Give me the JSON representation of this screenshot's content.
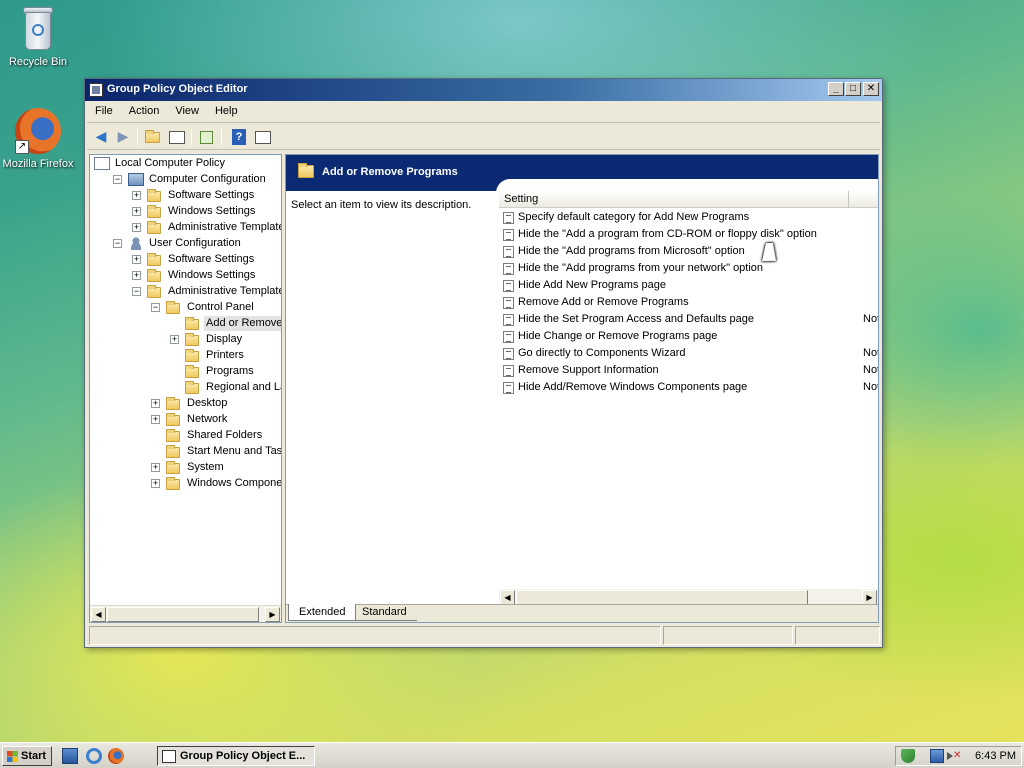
{
  "desktop": {
    "icons": [
      {
        "label": "Recycle Bin",
        "icon": "recycle-bin-icon"
      },
      {
        "label": "Mozilla Firefox",
        "icon": "firefox-icon"
      }
    ]
  },
  "window": {
    "title": "Group Policy Object Editor",
    "controls": {
      "minimize": "_",
      "maximize": "□",
      "close": "✕"
    },
    "menu": [
      "File",
      "Action",
      "View",
      "Help"
    ],
    "toolbar": [
      "back-arrow-icon",
      "forward-arrow-icon",
      "up-folder-icon",
      "show-hide-tree-icon",
      "export-list-icon",
      "help-icon",
      "properties-icon"
    ],
    "tree": [
      {
        "label": "Local Computer Policy",
        "icon": "policy-doc-icon"
      },
      {
        "label": "Computer Configuration",
        "icon": "computer-icon",
        "expander": "−"
      },
      {
        "label": "Software Settings",
        "icon": "folder-icon",
        "expander": "+"
      },
      {
        "label": "Windows Settings",
        "icon": "folder-icon",
        "expander": "+"
      },
      {
        "label": "Administrative Templates",
        "icon": "folder-icon",
        "expander": "+"
      },
      {
        "label": "User Configuration",
        "icon": "user-icon",
        "expander": "−"
      },
      {
        "label": "Software Settings",
        "icon": "folder-icon",
        "expander": "+"
      },
      {
        "label": "Windows Settings",
        "icon": "folder-icon",
        "expander": "+"
      },
      {
        "label": "Administrative Templates",
        "icon": "folder-icon",
        "expander": "−"
      },
      {
        "label": "Control Panel",
        "icon": "folder-icon",
        "expander": "−"
      },
      {
        "label": "Add or Remove Pro",
        "icon": "folder-open-icon",
        "expander": "",
        "selected": true
      },
      {
        "label": "Display",
        "icon": "folder-icon",
        "expander": "+"
      },
      {
        "label": "Printers",
        "icon": "folder-icon",
        "expander": ""
      },
      {
        "label": "Programs",
        "icon": "folder-icon",
        "expander": ""
      },
      {
        "label": "Regional and Langu",
        "icon": "folder-icon",
        "expander": ""
      },
      {
        "label": "Desktop",
        "icon": "folder-icon",
        "expander": "+"
      },
      {
        "label": "Network",
        "icon": "folder-icon",
        "expander": "+"
      },
      {
        "label": "Shared Folders",
        "icon": "folder-icon",
        "expander": ""
      },
      {
        "label": "Start Menu and Taskba",
        "icon": "folder-icon",
        "expander": ""
      },
      {
        "label": "System",
        "icon": "folder-icon",
        "expander": "+"
      },
      {
        "label": "Windows Components",
        "icon": "folder-icon",
        "expander": "+"
      }
    ],
    "details": {
      "header": "Add or Remove Programs",
      "description": "Select an item to view its description.",
      "column": "Setting",
      "settings": [
        {
          "name": "Specify default category for Add New Programs",
          "state": ""
        },
        {
          "name": "Hide the \"Add a program from CD-ROM or floppy disk\" option",
          "state": ""
        },
        {
          "name": "Hide the \"Add programs from Microsoft\" option",
          "state": ""
        },
        {
          "name": "Hide the \"Add programs from your network\" option",
          "state": ""
        },
        {
          "name": "Hide Add New Programs page",
          "state": ""
        },
        {
          "name": "Remove Add or Remove Programs",
          "state": ""
        },
        {
          "name": "Hide the Set Program Access and Defaults page",
          "state": "Not"
        },
        {
          "name": "Hide Change or Remove Programs page",
          "state": ""
        },
        {
          "name": "Go directly to Components Wizard",
          "state": "Not"
        },
        {
          "name": "Remove Support Information",
          "state": "Not"
        },
        {
          "name": "Hide Add/Remove Windows Components page",
          "state": "Not"
        }
      ],
      "tabs": [
        "Extended",
        "Standard"
      ],
      "active_tab": "Extended"
    }
  },
  "taskbar": {
    "start_label": "Start",
    "quick_launch": [
      "show-desktop-icon",
      "internet-explorer-icon",
      "firefox-icon"
    ],
    "task_button": "Group Policy Object E...",
    "tray_icons": [
      "security-shield-icon",
      "network-icon",
      "volume-muted-icon"
    ],
    "clock": "6:43 PM"
  }
}
